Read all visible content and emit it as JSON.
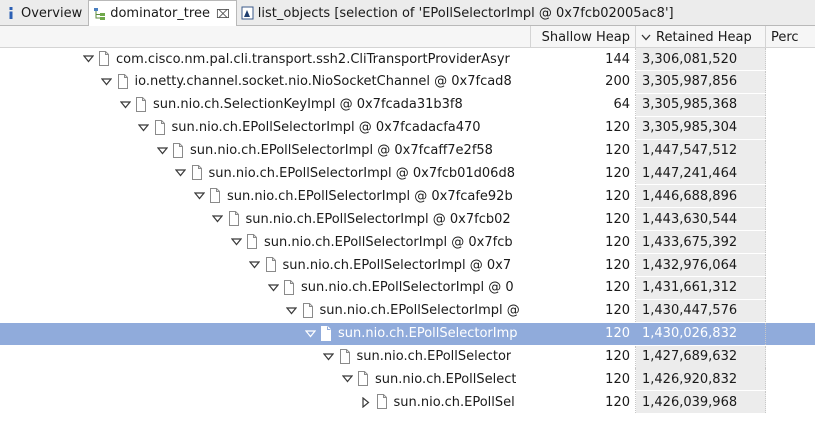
{
  "tabs": [
    {
      "label": "Overview",
      "icon": "info-icon",
      "closable": false,
      "active": false
    },
    {
      "label": "dominator_tree",
      "icon": "tree-icon",
      "closable": true,
      "active": true
    },
    {
      "label": "list_objects  [selection of 'EPollSelectorImpl @ 0x7fcb02005ac8']",
      "icon": "list-icon",
      "closable": false,
      "active": false
    }
  ],
  "columns": {
    "name": "",
    "shallow": "Shallow Heap",
    "retained": "Retained Heap",
    "perc": "Perc"
  },
  "rows": [
    {
      "name": "com.cisco.nm.pal.cli.transport.ssh2.CliTransportProviderAsyr",
      "shallow": "144",
      "retained": "3,306,081,520",
      "depth": 0,
      "expanded": true
    },
    {
      "name": "io.netty.channel.socket.nio.NioSocketChannel @ 0x7fcad8",
      "shallow": "200",
      "retained": "3,305,987,856",
      "depth": 1,
      "expanded": true
    },
    {
      "name": "sun.nio.ch.SelectionKeyImpl @ 0x7fcada31b3f8",
      "shallow": "64",
      "retained": "3,305,985,368",
      "depth": 2,
      "expanded": true
    },
    {
      "name": "sun.nio.ch.EPollSelectorImpl @ 0x7fcadacfa470",
      "shallow": "120",
      "retained": "3,305,985,304",
      "depth": 3,
      "expanded": true
    },
    {
      "name": "sun.nio.ch.EPollSelectorImpl @ 0x7fcaff7e2f58",
      "shallow": "120",
      "retained": "1,447,547,512",
      "depth": 4,
      "expanded": true
    },
    {
      "name": "sun.nio.ch.EPollSelectorImpl @ 0x7fcb01d06d8",
      "shallow": "120",
      "retained": "1,447,241,464",
      "depth": 5,
      "expanded": true
    },
    {
      "name": "sun.nio.ch.EPollSelectorImpl @ 0x7fcafe92b",
      "shallow": "120",
      "retained": "1,446,688,896",
      "depth": 6,
      "expanded": true
    },
    {
      "name": "sun.nio.ch.EPollSelectorImpl @ 0x7fcb02",
      "shallow": "120",
      "retained": "1,443,630,544",
      "depth": 7,
      "expanded": true
    },
    {
      "name": "sun.nio.ch.EPollSelectorImpl @ 0x7fcb",
      "shallow": "120",
      "retained": "1,433,675,392",
      "depth": 8,
      "expanded": true
    },
    {
      "name": "sun.nio.ch.EPollSelectorImpl @ 0x7",
      "shallow": "120",
      "retained": "1,432,976,064",
      "depth": 9,
      "expanded": true
    },
    {
      "name": "sun.nio.ch.EPollSelectorImpl @ 0",
      "shallow": "120",
      "retained": "1,431,661,312",
      "depth": 10,
      "expanded": true
    },
    {
      "name": "sun.nio.ch.EPollSelectorImpl @",
      "shallow": "120",
      "retained": "1,430,447,576",
      "depth": 11,
      "expanded": true
    },
    {
      "name": "sun.nio.ch.EPollSelectorImp",
      "shallow": "120",
      "retained": "1,430,026,832",
      "depth": 12,
      "expanded": true,
      "selected": true
    },
    {
      "name": "sun.nio.ch.EPollSelector",
      "shallow": "120",
      "retained": "1,427,689,632",
      "depth": 13,
      "expanded": true
    },
    {
      "name": "sun.nio.ch.EPollSelect",
      "shallow": "120",
      "retained": "1,426,920,832",
      "depth": 14,
      "expanded": true
    },
    {
      "name": "sun.nio.ch.EPollSel",
      "shallow": "120",
      "retained": "1,426,039,968",
      "depth": 15,
      "expanded": false
    }
  ],
  "colors": {
    "selection": "#90abdb",
    "retained_bg": "#ececec",
    "tabbar_bg": "#ececec"
  }
}
